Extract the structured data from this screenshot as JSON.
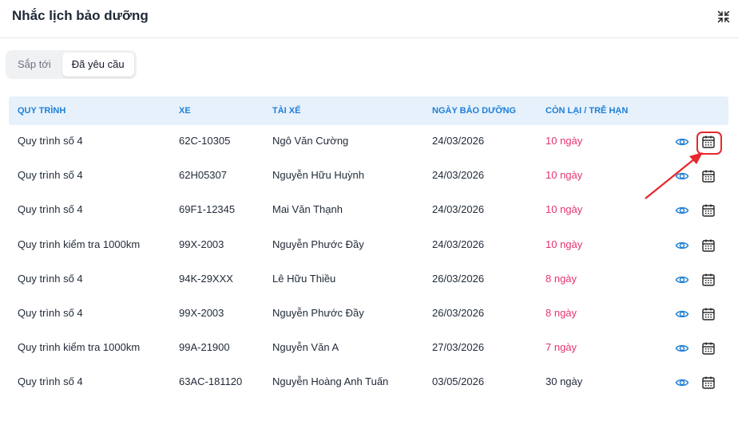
{
  "dialog": {
    "title": "Nhắc lịch bảo dưỡng"
  },
  "tabs": [
    {
      "label": "Sắp tới"
    },
    {
      "label": "Đã yêu cầu"
    }
  ],
  "table": {
    "headers": [
      "QUY TRÌNH",
      "XE",
      "TÀI XẾ",
      "NGÀY BẢO DƯỠNG",
      "CÒN LẠI / TRỄ HẠN"
    ],
    "rows": [
      {
        "process": "Quy trình số 4",
        "vehicle": "62C-10305",
        "driver": "Ngô Văn Cường",
        "date": "24/03/2026",
        "remaining": "10 ngày"
      },
      {
        "process": "Quy trình số 4",
        "vehicle": "62H05307",
        "driver": "Nguyễn Hữu Huỳnh",
        "date": "24/03/2026",
        "remaining": "10 ngày"
      },
      {
        "process": "Quy trình số 4",
        "vehicle": "69F1-12345",
        "driver": "Mai Văn Thạnh",
        "date": "24/03/2026",
        "remaining": "10 ngày"
      },
      {
        "process": "Quy trình kiểm tra 1000km",
        "vehicle": "99X-2003",
        "driver": "Nguyễn Phước Đầy",
        "date": "24/03/2026",
        "remaining": "10 ngày"
      },
      {
        "process": "Quy trình số 4",
        "vehicle": "94K-29XXX",
        "driver": "Lê Hữu Thiều",
        "date": "26/03/2026",
        "remaining": "8 ngày"
      },
      {
        "process": "Quy trình số 4",
        "vehicle": "99X-2003",
        "driver": "Nguyễn Phước Đầy",
        "date": "26/03/2026",
        "remaining": "8 ngày"
      },
      {
        "process": "Quy trình kiểm tra 1000km",
        "vehicle": "99A-21900",
        "driver": "Nguyễn Văn A",
        "date": "27/03/2026",
        "remaining": "7 ngày"
      },
      {
        "process": "Quy trình số 4",
        "vehicle": "63AC-181120",
        "driver": "Nguyễn Hoàng Anh Tuấn",
        "date": "03/05/2026",
        "remaining": "30 ngày"
      }
    ],
    "row_actions": [
      "eye-icon",
      "calendar-icon"
    ]
  },
  "colors": {
    "accent_blue": "#1f7fd6",
    "header_bg": "#e6f1fc",
    "overdue_pink": "#e5336d",
    "highlight_red": "#e8262c"
  }
}
